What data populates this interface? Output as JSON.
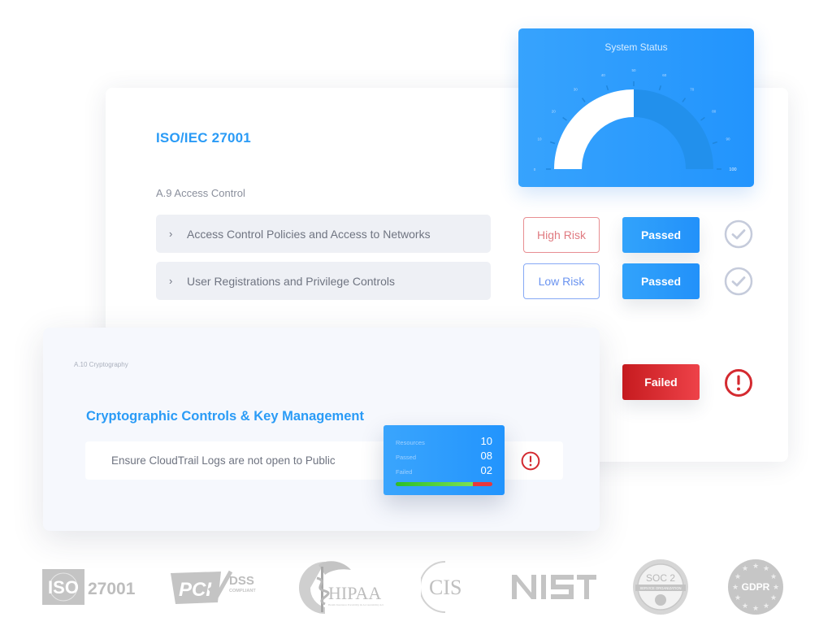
{
  "iso_card": {
    "title": "ISO/IEC 27001",
    "section_label": "A.9 Access Control",
    "controls": [
      {
        "label": "Access Control Policies and Access to Networks",
        "risk": "High Risk",
        "status": "Passed",
        "state_icon": "check-circle-icon"
      },
      {
        "label": "User Registrations and Privilege Controls",
        "risk": "Low Risk",
        "status": "Passed",
        "state_icon": "check-circle-icon"
      }
    ],
    "hidden_row": {
      "status": "Failed",
      "state_icon": "alert-circle-icon"
    },
    "chevron": "›"
  },
  "gauge": {
    "title": "System Status",
    "value": 50,
    "min": 0,
    "max": 100,
    "tick_labels": [
      "0",
      "10",
      "20",
      "30",
      "40",
      "50",
      "60",
      "70",
      "80",
      "90",
      "100"
    ]
  },
  "crypto_card": {
    "section_label": "A.10 Cryptography",
    "title": "Cryptographic Controls & Key Management",
    "check": "Ensure CloudTrail Logs are not open to Public"
  },
  "stats_popup": {
    "rows": [
      {
        "label": "Resources",
        "value": "10"
      },
      {
        "label": "Passed",
        "value": "08"
      },
      {
        "label": "Failed",
        "value": "02"
      }
    ],
    "passed_fraction": 0.8
  },
  "colors": {
    "accent_blue": "#2a9bf6",
    "pass_blue": "#2291fa",
    "fail_red": "#d9272d",
    "high_risk": "#e07a80",
    "low_risk": "#6a93f0"
  },
  "logos": [
    {
      "name": "ISO 27001",
      "text": "27001",
      "badge": "ISO"
    },
    {
      "name": "PCI DSS",
      "text": "DSS",
      "sub": "COMPLIANT",
      "badge": "PCI"
    },
    {
      "name": "HIPAA",
      "text": "HIPAA",
      "sub": "Health Insurance Portability & Accountability Act"
    },
    {
      "name": "CIS",
      "text": "CIS"
    },
    {
      "name": "NIST",
      "text": "NIST"
    },
    {
      "name": "SOC 2",
      "text": "SOC 2",
      "sub": "SERVICE ORGANIZATION"
    },
    {
      "name": "GDPR",
      "text": "GDPR"
    }
  ]
}
